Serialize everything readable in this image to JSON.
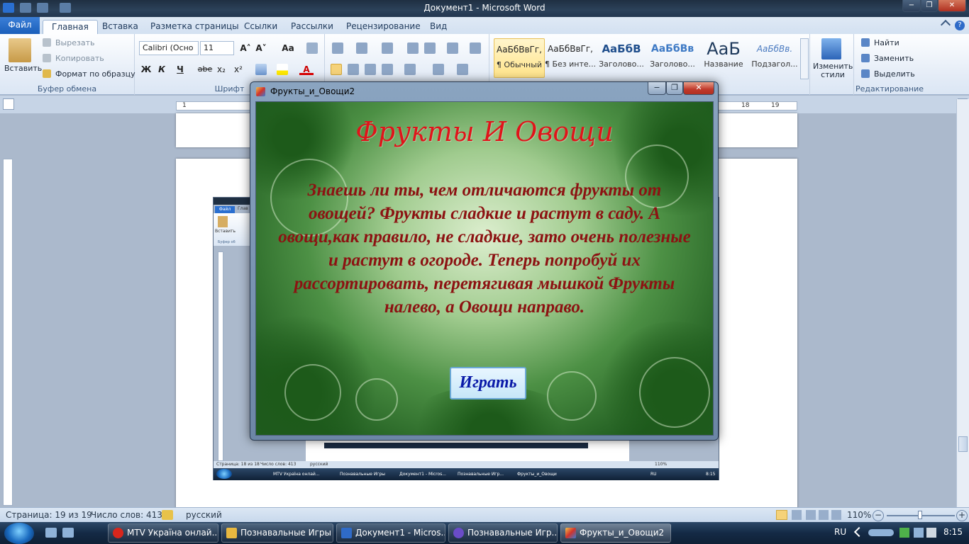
{
  "window": {
    "title": "Документ1 - Microsoft Word",
    "controls": [
      "−",
      "❐",
      "✕"
    ]
  },
  "tabs": {
    "file": "Файл",
    "items": [
      "Главная",
      "Вставка",
      "Разметка страницы",
      "Ссылки",
      "Рассылки",
      "Рецензирование",
      "Вид"
    ]
  },
  "ribbon": {
    "clipboard": {
      "paste": "Вставить",
      "cut": "Вырезать",
      "copy": "Копировать",
      "format_painter": "Формат по образцу",
      "label": "Буфер обмена"
    },
    "font": {
      "name": "Calibri (Осно",
      "size": "11",
      "label": "Шрифт",
      "bold": "Ж",
      "italic": "К",
      "underline": "Ч",
      "strike": "abe",
      "sub": "x₂",
      "sup": "x²",
      "grow": "A˄",
      "shrink": "A˅",
      "case": "Aa",
      "color": "A"
    },
    "styles": [
      {
        "sample": "АаБбВвГг,",
        "name": "¶ Обычный"
      },
      {
        "sample": "АаБбВвГг,",
        "name": "¶ Без инте..."
      },
      {
        "sample": "АаБбВ",
        "name": "Заголово..."
      },
      {
        "sample": "АаБбВв",
        "name": "Заголово..."
      },
      {
        "sample": "АаБ",
        "name": "Название"
      },
      {
        "sample": "АаБбВв.",
        "name": "Подзагол..."
      }
    ],
    "change_styles": "Изменить стили",
    "editing": {
      "find": "Найти",
      "replace": "Заменить",
      "select": "Выделить",
      "label": "Редактирование"
    }
  },
  "ruler": {
    "left_marks": [
      "1"
    ],
    "right_marks": [
      "18",
      "19"
    ]
  },
  "popup": {
    "title": "Фрукты_и_Овощи2",
    "heading": "Фрукты И Овощи",
    "text": "Знаешь ли ты, чем отличаются фрукты от овощей? Фрукты сладкие и растут в саду. А овощи,как правило, не сладкие, зато очень полезные и растут в огороде. Теперь попробуй их рассортировать, перетягивая мышкой Фрукты налево, а Овощи направо.",
    "play_button": "Играть"
  },
  "status": {
    "page": "Страница: 19 из 19",
    "words": "Число слов: 413",
    "lang": "русский",
    "zoom": "110%"
  },
  "mini": {
    "tab_file": "Файл",
    "tab_main": "Глав",
    "paste": "Вставить",
    "clip": "Буфер об",
    "status_page": "Страница: 18 из 18",
    "status_words": "Число слов: 413",
    "status_lang": "русский",
    "zoom": "110%",
    "lang": "RU",
    "time": "8:15",
    "taskbar": [
      "MTV Україна онлай...",
      "Познавальные Игры",
      "Документ1 - Micros...",
      "Познавальные Игр...",
      "Фрукты_и_Овощи"
    ]
  },
  "taskbar": {
    "items": [
      {
        "label": "MTV Україна онлай...",
        "color": "#d8261c"
      },
      {
        "label": "Познавальные Игры",
        "color": "#e8b840"
      },
      {
        "label": "Документ1 - Micros...",
        "color": "#2f6bc8"
      },
      {
        "label": "Познавальные Игр...",
        "color": "#6a4cc8"
      },
      {
        "label": "Фрукты_и_Овощи2",
        "color": "#c84a3a"
      }
    ],
    "lang": "RU",
    "time": "8:15"
  }
}
